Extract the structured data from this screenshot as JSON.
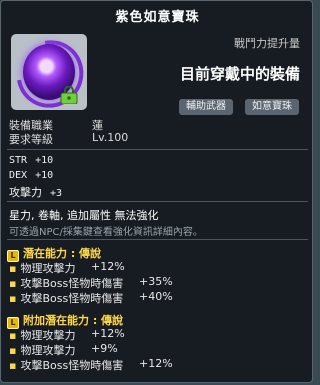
{
  "title": "紫色如意寶珠",
  "power_label": "戰鬥力提升量",
  "equipped_text": "目前穿戴中的裝備",
  "tags": [
    "輔助武器",
    "如意寶珠"
  ],
  "job": {
    "label": "裝備職業",
    "value": "蓮"
  },
  "level": {
    "label": "要求等級",
    "value": "Lv.100"
  },
  "stats": [
    {
      "name": "STR",
      "value": "+10"
    },
    {
      "name": "DEX",
      "value": "+10"
    },
    {
      "name": "攻擊力",
      "value": "+3"
    }
  ],
  "enhance_text": "星力, 卷軸, 追加屬性 無法強化",
  "hint_text": "可透過NPC/採集鍵查看強化資訊詳細內容。",
  "potential": {
    "header": "潛在能力 : 傳說",
    "badge": "L",
    "lines": [
      {
        "label": "物理攻擊力",
        "value": "+12%"
      },
      {
        "label": "攻擊Boss怪物時傷害",
        "value": "+35%"
      },
      {
        "label": "攻擊Boss怪物時傷害",
        "value": "+40%"
      }
    ]
  },
  "additional_potential": {
    "header": "附加潛在能力 : 傳說",
    "badge": "L",
    "lines": [
      {
        "label": "物理攻擊力",
        "value": "+12%"
      },
      {
        "label": "物理攻擊力",
        "value": "+9%"
      },
      {
        "label": "攻擊Boss怪物時傷害",
        "value": "+12%"
      }
    ]
  },
  "colors": {
    "legendary": "#ffd84a",
    "bg": "#161a20"
  }
}
